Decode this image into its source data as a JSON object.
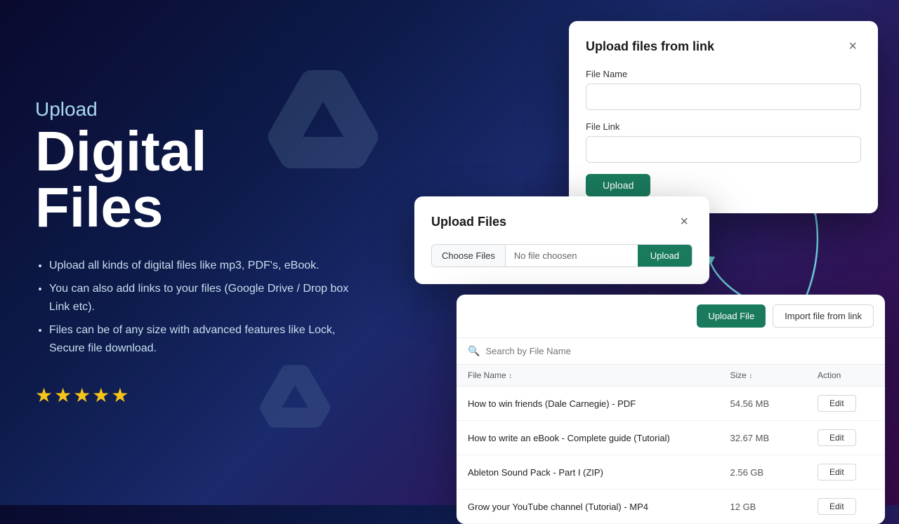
{
  "hero": {
    "subtitle": "Upload",
    "title": "Digital\nFiles",
    "bullets": [
      "Upload all kinds of digital files like mp3, PDF's, eBook.",
      "You can also add links to your files (Google Drive / Drop box Link etc).",
      "Files can be of any size with advanced features like Lock, Secure file download."
    ],
    "stars": "★★★★★"
  },
  "modal_link": {
    "title": "Upload files from link",
    "close_label": "×",
    "file_name_label": "File Name",
    "file_name_placeholder": "",
    "file_link_label": "File Link",
    "file_link_placeholder": "",
    "upload_button": "Upload"
  },
  "modal_upload": {
    "title": "Upload Files",
    "close_label": "×",
    "choose_files_btn": "Choose Files",
    "no_file_text": "No file choosen",
    "upload_button": "Upload"
  },
  "file_list": {
    "upload_file_btn": "Upload File",
    "import_link_btn": "Import file from link",
    "search_placeholder": "Search by File Name",
    "table_headers": {
      "file_name": "File Name",
      "size": "Size",
      "action": "Action"
    },
    "files": [
      {
        "name": "How to win friends (Dale Carnegie) - PDF",
        "size": "54.56 MB",
        "edit_label": "Edit"
      },
      {
        "name": "How to write an eBook - Complete guide (Tutorial)",
        "size": "32.67 MB",
        "edit_label": "Edit"
      },
      {
        "name": "Ableton Sound Pack - Part I (ZIP)",
        "size": "2.56 GB",
        "edit_label": "Edit"
      },
      {
        "name": "Grow your YouTube channel (Tutorial) - MP4",
        "size": "12 GB",
        "edit_label": "Edit"
      }
    ]
  },
  "colors": {
    "green": "#1a7a5e",
    "arrow_blue": "#6ecfdb"
  }
}
